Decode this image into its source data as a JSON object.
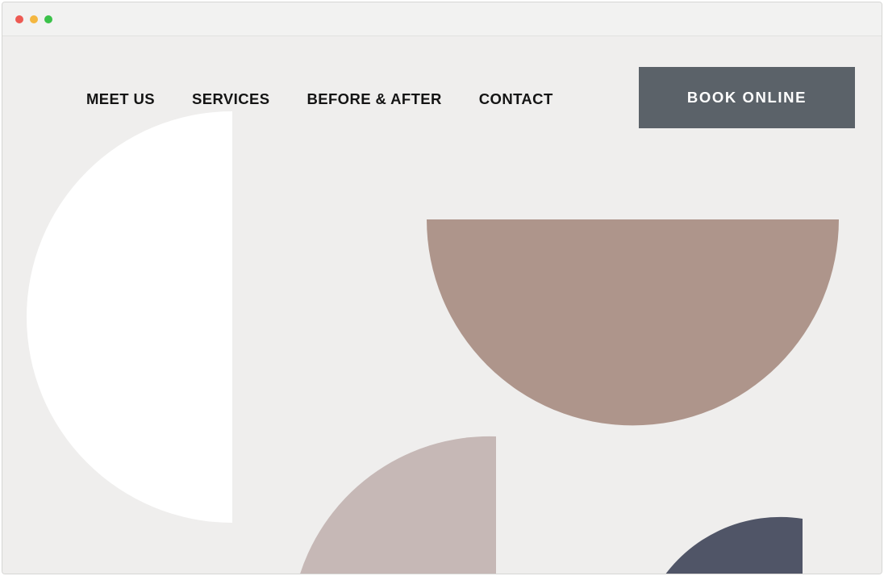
{
  "window": {
    "controls": [
      {
        "name": "close",
        "color": "#ed5a53"
      },
      {
        "name": "minimize",
        "color": "#f4b740"
      },
      {
        "name": "maximize",
        "color": "#3bc24a"
      }
    ]
  },
  "nav": {
    "links": [
      "MEET US",
      "SERVICES",
      "BEFORE & AFTER",
      "CONTACT"
    ],
    "cta_label": "BOOK ONLINE"
  },
  "colors": {
    "page_background": "#efeeed",
    "cta_background": "#5b6269",
    "shape_white": "#ffffff",
    "shape_taupe": "#ae958b",
    "shape_blush": "#c6b8b6",
    "shape_slate": "#505567"
  }
}
